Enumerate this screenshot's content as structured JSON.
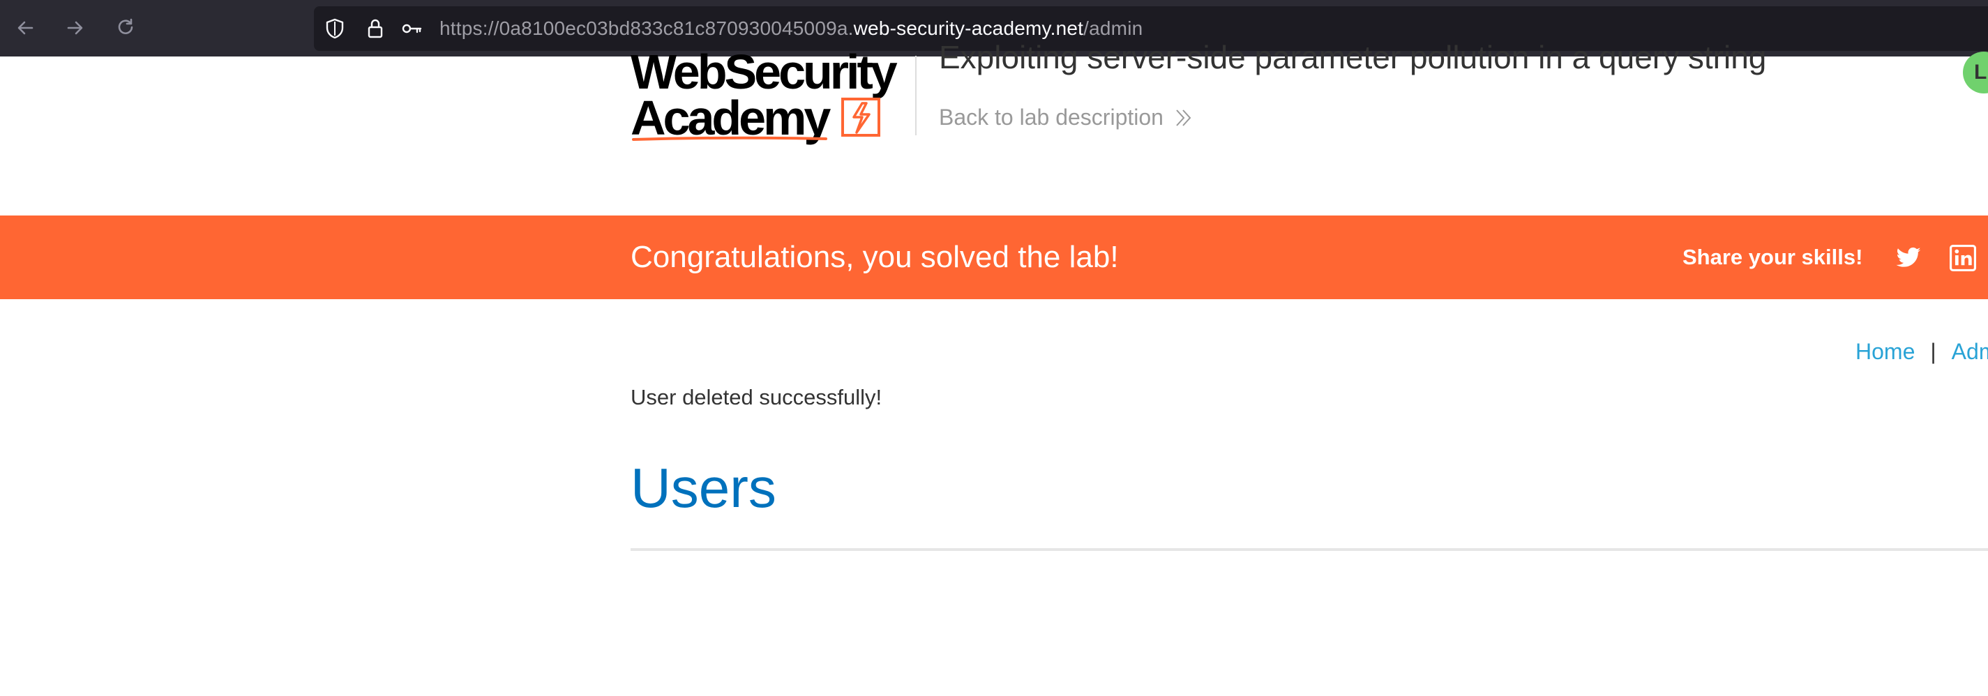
{
  "browser": {
    "url_prefix": "https://0a8100ec03bd833c81c870930045009a.",
    "url_domain": "web-security-academy.net",
    "url_path": "/admin",
    "icons": [
      "back-arrow-icon",
      "forward-arrow-icon",
      "reload-icon",
      "shield-icon",
      "lock-icon",
      "key-icon"
    ]
  },
  "header": {
    "logo_line1": "WebSecurity",
    "logo_line2": "Academy",
    "lab_title": "Exploiting server-side parameter pollution in a query string",
    "back_link": "Back to lab description",
    "status_initial": "L"
  },
  "banner": {
    "message": "Congratulations, you solved the lab!",
    "share_label": "Share your skills!",
    "social_icons": [
      "twitter-icon",
      "linkedin-icon"
    ]
  },
  "nav": {
    "home": "Home",
    "separator": "|",
    "admin": "Adm"
  },
  "main": {
    "notice": "User deleted successfully!",
    "heading": "Users"
  },
  "colors": {
    "banner": "#ff6633",
    "link": "#29a3d6",
    "heading": "#0071bc",
    "chrome": "#2b2a33",
    "urlbar": "#1c1b22"
  }
}
